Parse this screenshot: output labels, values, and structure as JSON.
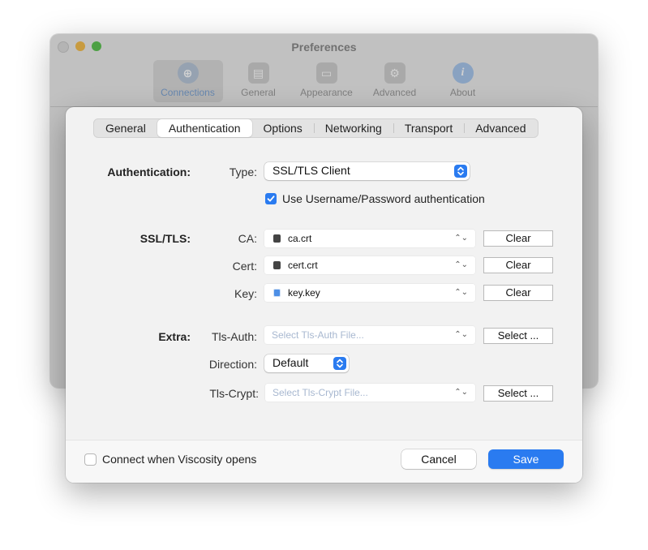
{
  "window": {
    "title": "Preferences",
    "toolbar": [
      {
        "label": "Connections",
        "icon": "connections-icon"
      },
      {
        "label": "General",
        "icon": "general-icon"
      },
      {
        "label": "Appearance",
        "icon": "appearance-icon"
      },
      {
        "label": "Advanced",
        "icon": "gear-icon"
      },
      {
        "label": "About",
        "icon": "info-icon"
      }
    ]
  },
  "tabs": [
    "General",
    "Authentication",
    "Options",
    "Networking",
    "Transport",
    "Advanced"
  ],
  "active_tab": "Authentication",
  "authentication": {
    "section_label": "Authentication:",
    "type_label": "Type:",
    "type_value": "SSL/TLS Client",
    "use_password_label": "Use Username/Password authentication",
    "use_password_checked": true
  },
  "ssl": {
    "section_label": "SSL/TLS:",
    "ca": {
      "label": "CA:",
      "file": "ca.crt",
      "button": "Clear"
    },
    "cert": {
      "label": "Cert:",
      "file": "cert.crt",
      "button": "Clear"
    },
    "key": {
      "label": "Key:",
      "file": "key.key",
      "button": "Clear"
    }
  },
  "extra": {
    "section_label": "Extra:",
    "tls_auth": {
      "label": "Tls-Auth:",
      "placeholder": "Select Tls-Auth File...",
      "button": "Select ..."
    },
    "direction": {
      "label": "Direction:",
      "value": "Default"
    },
    "tls_crypt": {
      "label": "Tls-Crypt:",
      "placeholder": "Select Tls-Crypt File...",
      "button": "Select ..."
    }
  },
  "footer": {
    "connect_label": "Connect when Viscosity opens",
    "connect_checked": false,
    "cancel": "Cancel",
    "save": "Save"
  },
  "colors": {
    "accent": "#2a7bf0",
    "close": "#dcdcdc",
    "minimize": "#f4bd4f",
    "maximize": "#5fc454"
  }
}
